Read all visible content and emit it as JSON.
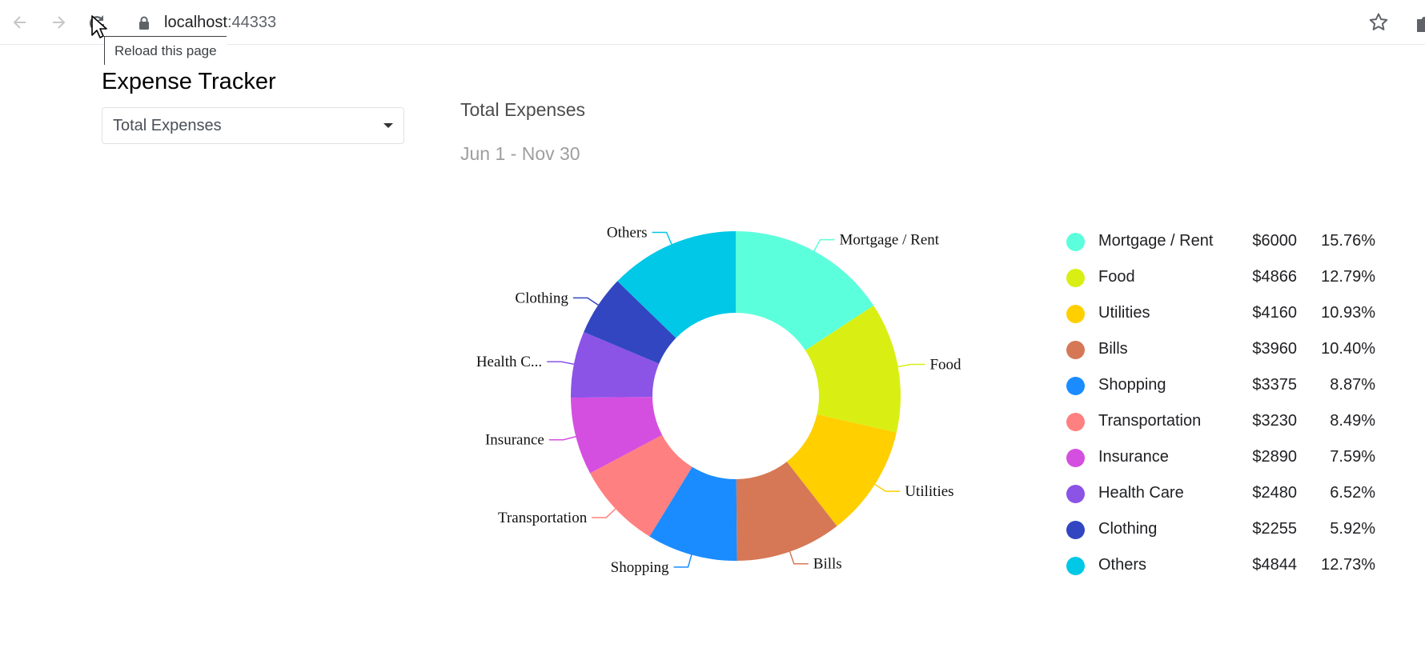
{
  "browser": {
    "url_host": "localhost",
    "url_port": ":44333",
    "tooltip": "Reload this page",
    "icons": [
      "back-arrow-icon",
      "forward-arrow-icon",
      "reload-icon",
      "lock-icon",
      "star-icon",
      "extensions-icon"
    ]
  },
  "app": {
    "title": "Expense Tracker",
    "select": {
      "value": "Total Expenses"
    }
  },
  "chart": {
    "title": "Total Expenses",
    "subtitle": "Jun 1 - Nov 30"
  },
  "chart_data": {
    "type": "pie",
    "title": "Total Expenses",
    "subtitle": "Jun 1 - Nov 30",
    "donut": true,
    "legend_position": "right",
    "slices": [
      {
        "name": "Mortgage / Rent",
        "label": "Mortgage / Rent",
        "amount": "$6000",
        "value": 6000,
        "percent": "15.76%",
        "color": "#5cffdb"
      },
      {
        "name": "Food",
        "label": "Food",
        "amount": "$4866",
        "value": 4866,
        "percent": "12.79%",
        "color": "#d9ef14"
      },
      {
        "name": "Utilities",
        "label": "Utilities",
        "amount": "$4160",
        "value": 4160,
        "percent": "10.93%",
        "color": "#ffcf00"
      },
      {
        "name": "Bills",
        "label": "Bills",
        "amount": "$3960",
        "value": 3960,
        "percent": "10.40%",
        "color": "#d67856"
      },
      {
        "name": "Shopping",
        "label": "Shopping",
        "amount": "$3375",
        "value": 3375,
        "percent": "8.87%",
        "color": "#1a8cff"
      },
      {
        "name": "Transportation",
        "label": "Transportation",
        "amount": "$3230",
        "value": 3230,
        "percent": "8.49%",
        "color": "#ff8080"
      },
      {
        "name": "Insurance",
        "label": "Insurance",
        "amount": "$2890",
        "value": 2890,
        "percent": "7.59%",
        "color": "#d44fe0"
      },
      {
        "name": "Health Care",
        "label": "Health C...",
        "amount": "$2480",
        "value": 2480,
        "percent": "6.52%",
        "color": "#8b53e6"
      },
      {
        "name": "Clothing",
        "label": "Clothing",
        "amount": "$2255",
        "value": 2255,
        "percent": "5.92%",
        "color": "#3246c1"
      },
      {
        "name": "Others",
        "label": "Others",
        "amount": "$4844",
        "value": 4844,
        "percent": "12.73%",
        "color": "#00c8e6"
      }
    ]
  }
}
